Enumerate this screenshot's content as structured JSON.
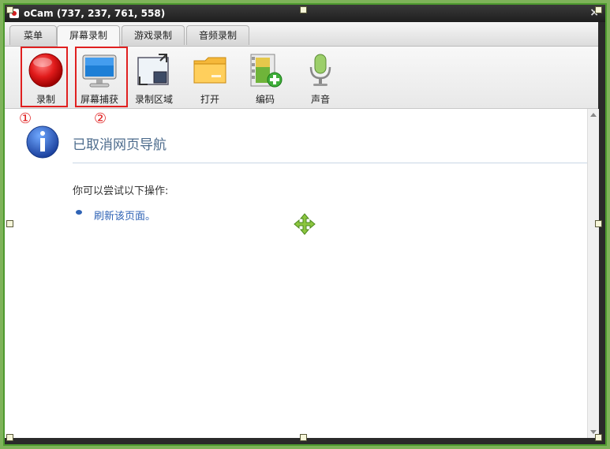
{
  "window": {
    "title": "oCam (737, 237, 761, 558)",
    "close_glyph": "×"
  },
  "tabs": [
    {
      "label": "菜单"
    },
    {
      "label": "屏幕录制"
    },
    {
      "label": "游戏录制"
    },
    {
      "label": "音频录制"
    }
  ],
  "toolbar": {
    "items": [
      {
        "label": "录制",
        "icon": "record-icon"
      },
      {
        "label": "屏幕捕获",
        "icon": "monitor-icon"
      },
      {
        "label": "录制区域",
        "icon": "record-area-icon"
      },
      {
        "label": "打开",
        "icon": "folder-icon"
      },
      {
        "label": "编码",
        "icon": "film-add-icon"
      },
      {
        "label": "声音",
        "icon": "microphone-icon"
      }
    ]
  },
  "annotations": {
    "one": "①",
    "two": "②",
    "color": "#e02020"
  },
  "content": {
    "heading": "已取消网页导航",
    "subtext": "你可以尝试以下操作:",
    "refresh_link": "刷新该页面。"
  }
}
